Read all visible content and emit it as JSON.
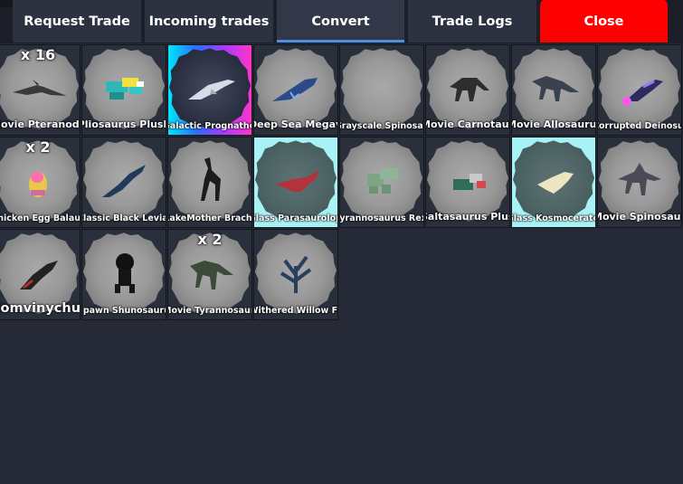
{
  "tabs": [
    {
      "label": "Request Trade",
      "active": false
    },
    {
      "label": "Incoming trades",
      "active": false
    },
    {
      "label": "Convert",
      "active": true
    },
    {
      "label": "Trade Logs",
      "active": false
    }
  ],
  "close_label": "Close",
  "items": [
    {
      "name": "Movie Pteranodon",
      "qty": "x 16",
      "bg": "default"
    },
    {
      "name": "Pliosaurus Plush",
      "qty": "",
      "bg": "default"
    },
    {
      "name": "Galactic Prognathodon",
      "qty": "",
      "bg": "galactic"
    },
    {
      "name": "Deep Sea Megavore",
      "qty": "",
      "bg": "default"
    },
    {
      "name": "Grayscale Spinosaurus",
      "qty": "",
      "bg": "default"
    },
    {
      "name": "Movie Carnotaurus",
      "qty": "",
      "bg": "default"
    },
    {
      "name": "Movie Allosaurus",
      "qty": "",
      "bg": "default"
    },
    {
      "name": "Corrupted Deinosuchus",
      "qty": "",
      "bg": "default"
    },
    {
      "name": "Chicken Egg Balaur",
      "qty": "x 2",
      "bg": "default"
    },
    {
      "name": "Classic Black Leviathan",
      "qty": "",
      "bg": "default"
    },
    {
      "name": "RakeMother Brachiosaurus",
      "qty": "",
      "bg": "default"
    },
    {
      "name": "Glass Parasaurolophus",
      "qty": "",
      "bg": "glass"
    },
    {
      "name": "Tyrannosaurus Rex Plush",
      "qty": "",
      "bg": "default"
    },
    {
      "name": "Saltasaurus Plush",
      "qty": "",
      "bg": "default"
    },
    {
      "name": "Glass Kosmoceratops",
      "qty": "",
      "bg": "glass"
    },
    {
      "name": "Movie Spinosaurus",
      "qty": "",
      "bg": "default"
    },
    {
      "name": "Zomvinychus",
      "qty": "",
      "bg": "default"
    },
    {
      "name": "Spawn Shunosaurus",
      "qty": "",
      "bg": "default"
    },
    {
      "name": "Movie Tyrannosaurus Rex",
      "qty": "x 2",
      "bg": "default"
    },
    {
      "name": "Withered Willow Futalognkosaurus",
      "qty": "",
      "bg": "default"
    }
  ],
  "colors": {
    "accent": "#4d8fe0",
    "close": "#ff0000",
    "glass_bg": "#a6f2f6"
  }
}
